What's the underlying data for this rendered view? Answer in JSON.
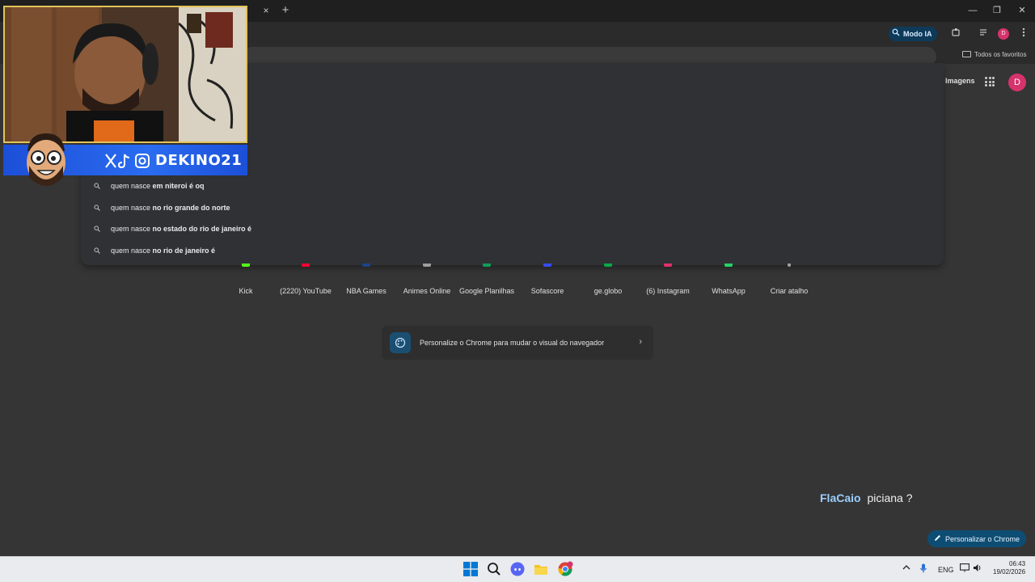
{
  "window": {
    "close_tab": "×",
    "new_tab": "+",
    "minimize": "—",
    "maximize": "❐",
    "close": "✕"
  },
  "toolbar": {
    "modo_ia_label": "Modo IA",
    "bookmarks_folder": "Todos os favoritos",
    "profile_initial": "D"
  },
  "google": {
    "images_link": "Imagens",
    "avatar_initial": "D"
  },
  "suggestions": [
    {
      "prefix": "quem nasce ",
      "completion": "em niteroi é oq"
    },
    {
      "prefix": "quem nasce ",
      "completion": "no rio grande do norte"
    },
    {
      "prefix": "quem nasce ",
      "completion": "no estado do rio de janeiro é"
    },
    {
      "prefix": "quem nasce ",
      "completion": "no rio de janeiro é"
    }
  ],
  "shortcuts": [
    {
      "label": "Kick",
      "color": "#53fc18"
    },
    {
      "label": "(2220) YouTube",
      "color": "#ff0033"
    },
    {
      "label": "NBA Games",
      "color": "#1d428a"
    },
    {
      "label": "Animes Online",
      "color": "#9e9e9e"
    },
    {
      "label": "Google Planilhas",
      "color": "#0f9d58"
    },
    {
      "label": "Sofascore",
      "color": "#374df5"
    },
    {
      "label": "ge.globo",
      "color": "#06aa48"
    },
    {
      "label": "(6) Instagram",
      "color": "#e1306c"
    },
    {
      "label": "WhatsApp",
      "color": "#25d366"
    },
    {
      "label": "Criar atalho",
      "color": "#9e9e9e"
    }
  ],
  "customize_card": {
    "text": "Personalize o Chrome para mudar o visual do navegador"
  },
  "overlay_message": {
    "name": "FlaCaio",
    "text": "piciana ?"
  },
  "personalize_button": {
    "label": "Personalizar o Chrome"
  },
  "webcam": {
    "handle": "DEKINO21"
  },
  "taskbar": {
    "language": "ENG",
    "time": "06:43",
    "date": "19/02/2026"
  },
  "colors": {
    "page_bg": "#353535",
    "accent_blue": "#0e4d73",
    "profile_pink": "#d6336c"
  }
}
